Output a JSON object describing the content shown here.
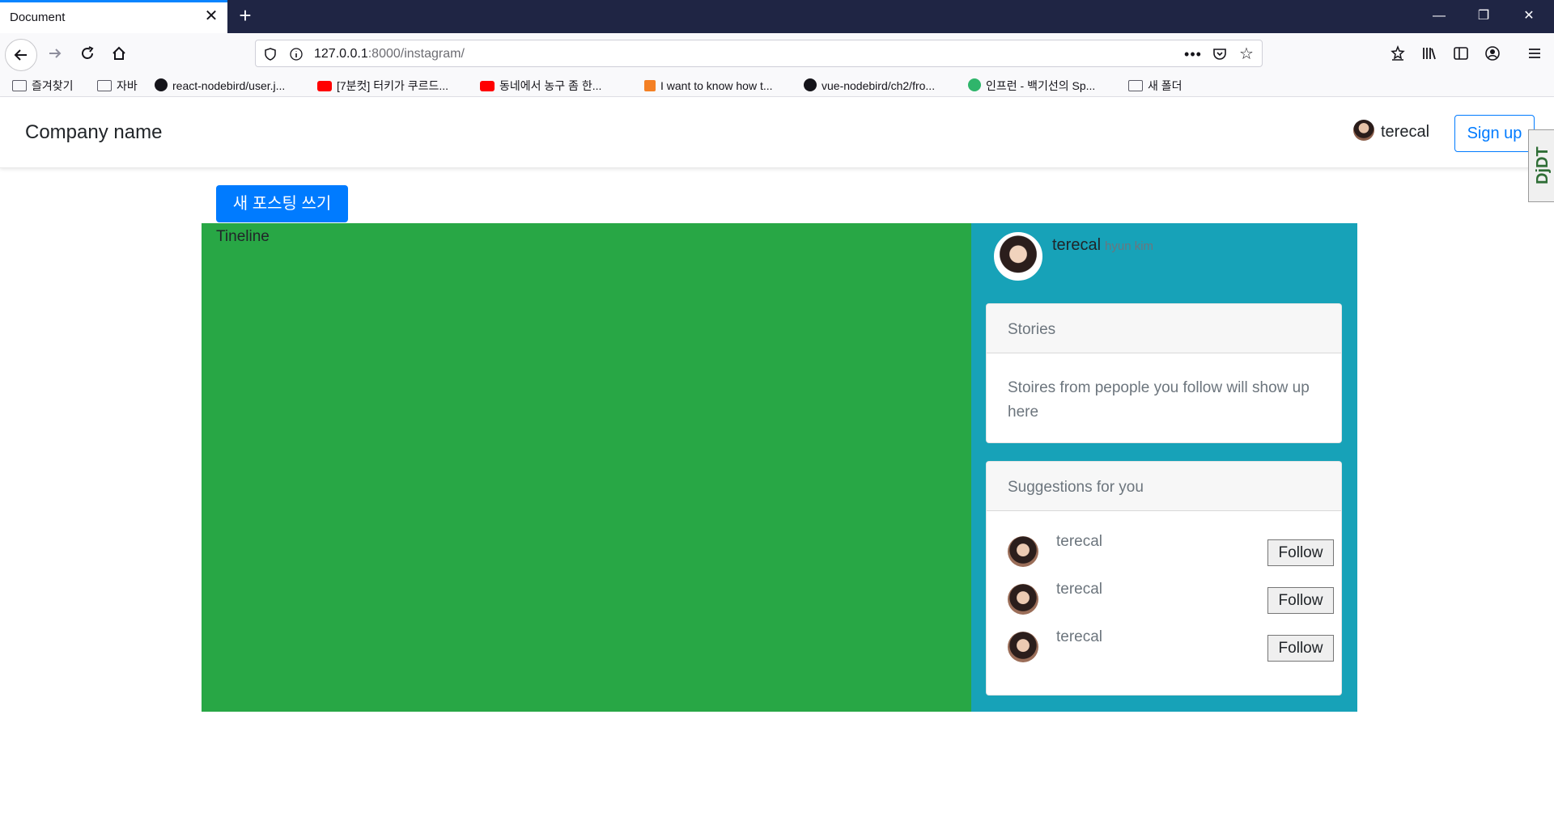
{
  "browser": {
    "tab_title": "Document",
    "tab_close": "✕",
    "new_tab": "+",
    "url_host": "127.0.0.1",
    "url_path": ":8000/instagram/",
    "bookmarks": [
      {
        "label": "즐겨찾기",
        "icon": "folder-icon"
      },
      {
        "label": "자바",
        "icon": "folder-icon"
      },
      {
        "label": "react-nodebird/user.j...",
        "icon": "github-icon"
      },
      {
        "label": "[7분컷] 터키가 쿠르드...",
        "icon": "youtube-icon"
      },
      {
        "label": "동네에서 농구 좀 한...",
        "icon": "youtube-icon"
      },
      {
        "label": "I want to know how t...",
        "icon": "stackoverflow-icon"
      },
      {
        "label": "vue-nodebird/ch2/fro...",
        "icon": "github-icon"
      },
      {
        "label": "인프런 - 백기선의 Sp...",
        "icon": "inflearn-icon"
      },
      {
        "label": "새 폴더",
        "icon": "folder-icon"
      }
    ],
    "window_controls": {
      "minimize": "—",
      "restore": "❐",
      "close": "✕"
    }
  },
  "header": {
    "brand": "Company name",
    "username": "terecal",
    "signup_label": "Sign up",
    "extension_label": "DjDT"
  },
  "main": {
    "new_post_label": "새 포스팅 쓰기",
    "timeline_label": "Tineline",
    "colors": {
      "timeline_bg": "#28a745",
      "sidebar_bg": "#17a2b8",
      "primary": "#007bff"
    }
  },
  "sidebar": {
    "profile_name": "terecal",
    "profile_subname": "hyun kim",
    "stories": {
      "title": "Stories",
      "body": "Stoires from pepople you follow will show up here"
    },
    "suggestions": {
      "title": "Suggestions for you",
      "items": [
        {
          "name": "terecal",
          "button": "Follow"
        },
        {
          "name": "terecal",
          "button": "Follow"
        },
        {
          "name": "terecal",
          "button": "Follow"
        }
      ]
    }
  }
}
